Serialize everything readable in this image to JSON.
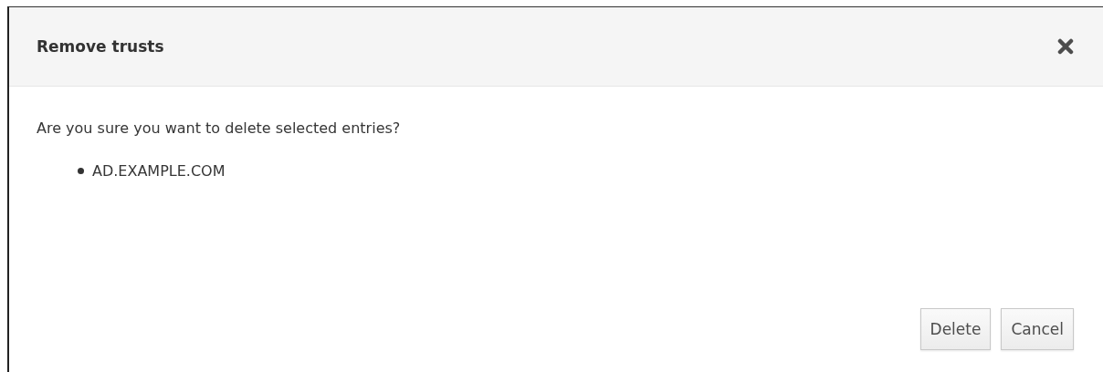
{
  "dialog": {
    "title": "Remove trusts",
    "message": "Are you sure you want to delete selected entries?",
    "entries": [
      "AD.EXAMPLE.COM"
    ],
    "buttons": [
      "Delete",
      "Cancel"
    ]
  }
}
